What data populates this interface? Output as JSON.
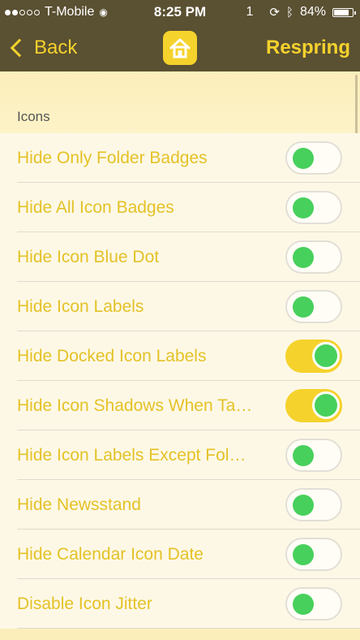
{
  "status_bar": {
    "carrier": "T-Mobile",
    "signal_dots": [
      true,
      true,
      false,
      false,
      false
    ],
    "time": "8:25 PM",
    "notification_count": "1",
    "battery_percent": "84%",
    "battery_level": 0.84
  },
  "nav": {
    "back_label": "Back",
    "center_icon": "home-icon",
    "right_label": "Respring"
  },
  "section": {
    "title": "Icons"
  },
  "items": [
    {
      "label": "Hide Only Folder Badges",
      "on": false
    },
    {
      "label": "Hide All Icon Badges",
      "on": false
    },
    {
      "label": "Hide Icon Blue Dot",
      "on": false
    },
    {
      "label": "Hide Icon Labels",
      "on": false
    },
    {
      "label": "Hide Docked Icon Labels",
      "on": true
    },
    {
      "label": "Hide Icon Shadows When Ta…",
      "on": true
    },
    {
      "label": "Hide Icon Labels Except Fol…",
      "on": false
    },
    {
      "label": "Hide Newsstand",
      "on": false
    },
    {
      "label": "Hide Calendar Icon Date",
      "on": false
    },
    {
      "label": "Disable Icon Jitter",
      "on": false
    }
  ],
  "colors": {
    "accent": "#f5d22c",
    "bar": "#5a5032",
    "knob": "#47d05c",
    "background": "#fdf8e6"
  }
}
